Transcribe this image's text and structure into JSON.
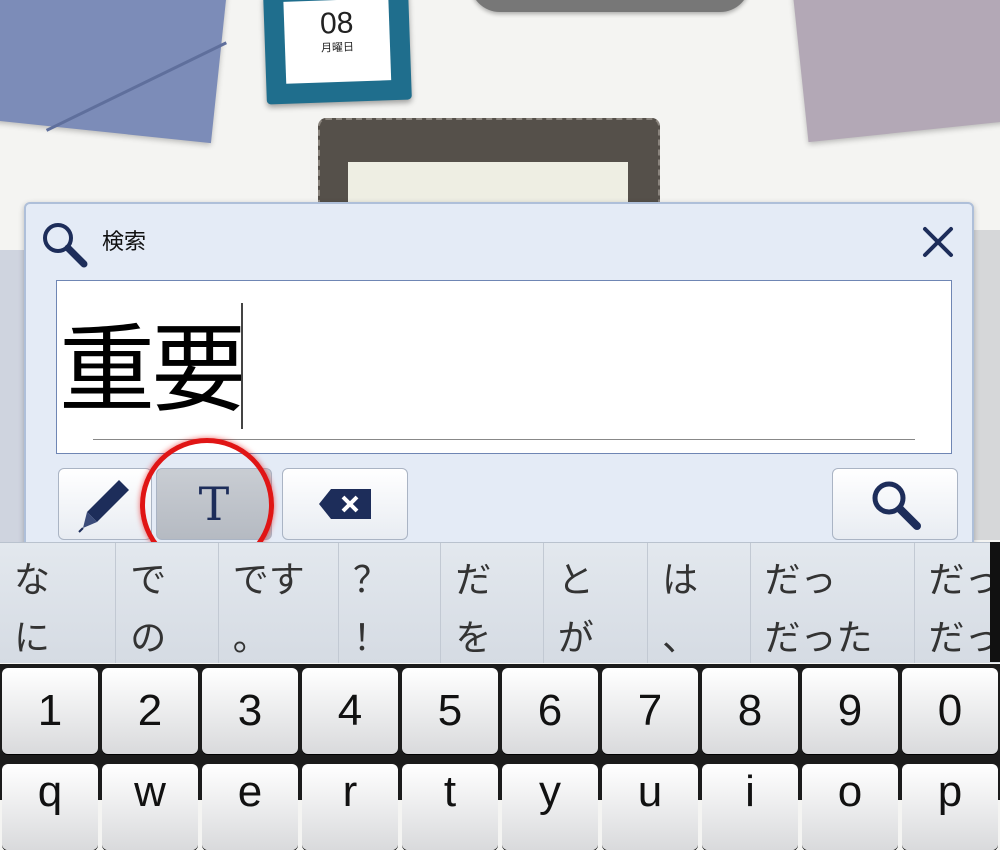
{
  "background": {
    "calendar_day": "08",
    "calendar_weekday": "月曜日"
  },
  "dialog": {
    "title": "検索",
    "input_value": "重要",
    "close_icon": "close-icon",
    "title_icon": "search-icon"
  },
  "toolbar": {
    "pen_icon": "pen-icon",
    "text_mode_label": "T",
    "backspace_icon": "backspace-icon",
    "search_icon": "search-icon"
  },
  "candidates": [
    {
      "top": "な",
      "bottom": "に"
    },
    {
      "top": "で",
      "bottom": "の"
    },
    {
      "top": "です",
      "bottom": "。"
    },
    {
      "top": "？",
      "bottom": "！"
    },
    {
      "top": "だ",
      "bottom": "を"
    },
    {
      "top": "と",
      "bottom": "が"
    },
    {
      "top": "は",
      "bottom": "、"
    },
    {
      "top": "だっ",
      "bottom": "だった"
    },
    {
      "top": "だっ",
      "bottom": "だっ"
    }
  ],
  "keyboard": {
    "number_row": [
      "1",
      "2",
      "3",
      "4",
      "5",
      "6",
      "7",
      "8",
      "9",
      "0"
    ],
    "letter_row_partial": [
      "q",
      "w",
      "e",
      "r",
      "t",
      "y",
      "u",
      "i",
      "o",
      "p"
    ]
  },
  "colors": {
    "highlight_ring": "#e01515",
    "dialog_bg": "#e4ebf6",
    "icon_navy": "#1d2d5a"
  }
}
